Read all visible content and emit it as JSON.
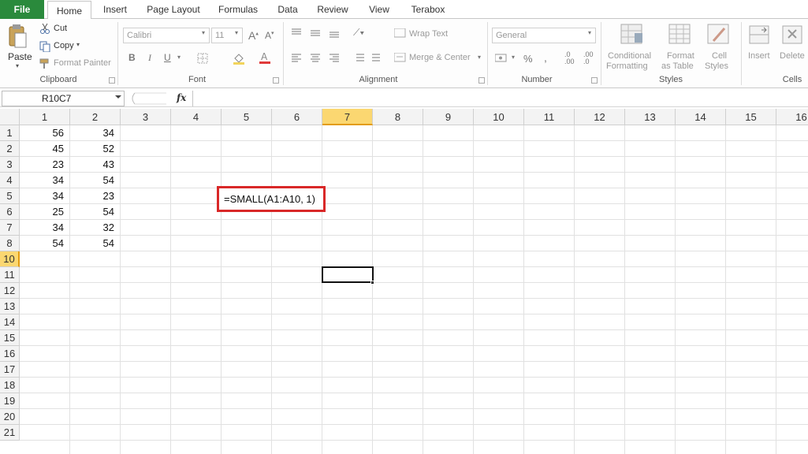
{
  "tabs": [
    "File",
    "Home",
    "Insert",
    "Page Layout",
    "Formulas",
    "Data",
    "Review",
    "View",
    "Terabox"
  ],
  "clipboard": {
    "paste": "Paste",
    "cut": "Cut",
    "copy": "Copy",
    "format_painter": "Format Painter",
    "label": "Clipboard"
  },
  "font": {
    "name": "Calibri",
    "size": "11",
    "bold": "B",
    "italic": "I",
    "underline": "U",
    "label": "Font"
  },
  "alignment": {
    "wrap_text": "Wrap Text",
    "merge_center": "Merge & Center",
    "label": "Alignment"
  },
  "number": {
    "format": "General",
    "percent": "%",
    "comma": ",",
    "label": "Number"
  },
  "styles": {
    "conditional_1": "Conditional",
    "conditional_2": "Formatting",
    "format_table_1": "Format",
    "format_table_2": "as Table",
    "cell_styles_1": "Cell",
    "cell_styles_2": "Styles",
    "label": "Styles"
  },
  "cells_group": {
    "insert": "Insert",
    "delete": "Delete",
    "label": "Cells"
  },
  "formula_bar": {
    "name_box": "R10C7",
    "fx": "fx"
  },
  "columns": [
    "1",
    "2",
    "3",
    "4",
    "5",
    "6",
    "7",
    "8",
    "9",
    "10",
    "11",
    "12",
    "13",
    "14",
    "15",
    "16"
  ],
  "rows": [
    "1",
    "2",
    "3",
    "4",
    "5",
    "6",
    "7",
    "8",
    "10",
    "11",
    "12",
    "13",
    "14",
    "15",
    "16",
    "17",
    "18",
    "19",
    "20",
    "21"
  ],
  "selected_column": "7",
  "selected_row": "10",
  "data": {
    "col1": [
      "56",
      "45",
      "23",
      "34",
      "34",
      "25",
      "34",
      "54"
    ],
    "col2": [
      "34",
      "52",
      "43",
      "54",
      "23",
      "54",
      "32",
      "54"
    ]
  },
  "formula_text": "=SMALL(A1:A10, 1)",
  "colors": {
    "file_tab": "#2a8a3c",
    "selected_header": "#fbd771",
    "highlight_box": "#d92828"
  }
}
